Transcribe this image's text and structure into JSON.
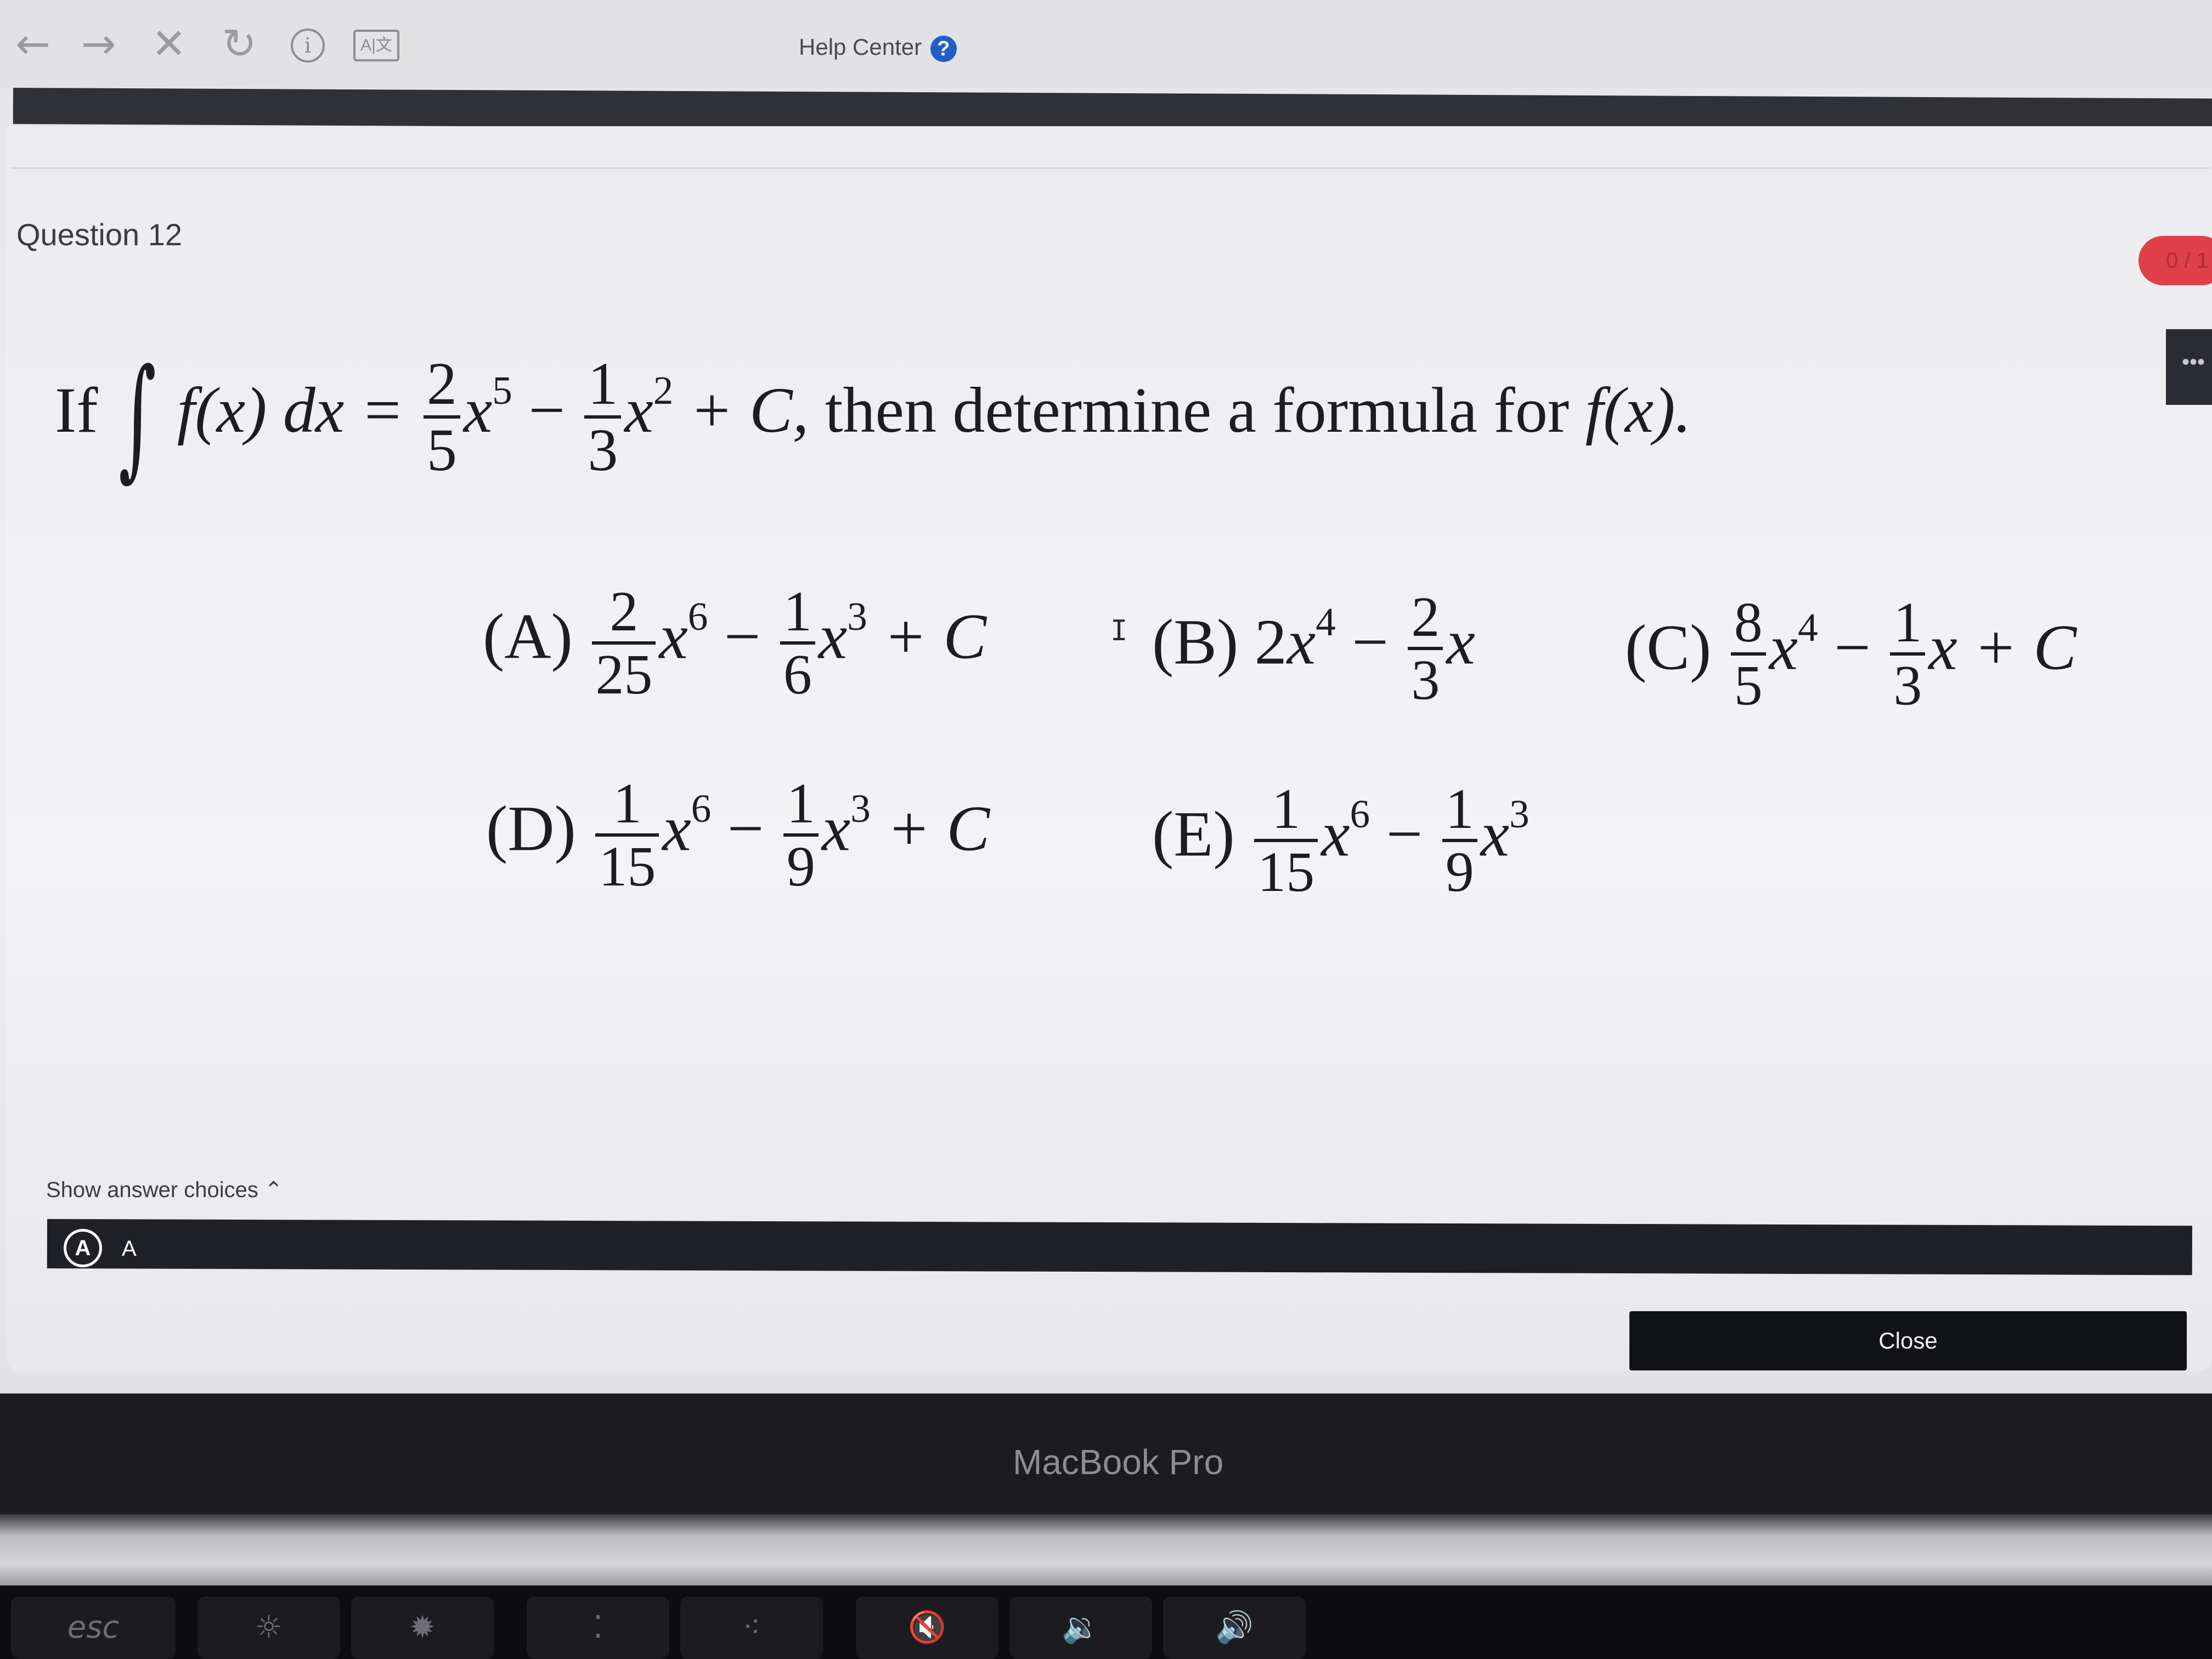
{
  "browser": {
    "back_icon": "←",
    "forward_icon": "→",
    "stop_icon": "✕",
    "reload_icon": "↻",
    "info_icon": "i",
    "translate_icon": "A|文",
    "help_center_label": "Help Center",
    "help_icon": "?"
  },
  "question": {
    "label": "Question 12",
    "score_badge": "0 / 1",
    "more_icon": "•••",
    "prompt": {
      "if": "If",
      "integral_symbol": "∫",
      "fx_dx": "f(x) dx =",
      "frac1_num": "2",
      "frac1_den": "5",
      "term1": "x",
      "term1_exp": "5",
      "minus": "−",
      "frac2_num": "1",
      "frac2_den": "3",
      "term2": "x",
      "term2_exp": "2",
      "plus_c": "+ C,",
      "tail": "then determine a formula for",
      "tail_fx": "f(x)."
    },
    "choices": {
      "A": {
        "label": "(A)",
        "f1n": "2",
        "f1d": "25",
        "x1": "x",
        "e1": "6",
        "op": "−",
        "f2n": "1",
        "f2d": "6",
        "x2": "x",
        "e2": "3",
        "end": "+ C"
      },
      "B": {
        "label": "(B)",
        "lead": "2",
        "x1": "x",
        "e1": "4",
        "op": "−",
        "f2n": "2",
        "f2d": "3",
        "x2": "x"
      },
      "C": {
        "label": "(C)",
        "f1n": "8",
        "f1d": "5",
        "x1": "x",
        "e1": "4",
        "op": "−",
        "f2n": "1",
        "f2d": "3",
        "x2": "x",
        "end": "+ C"
      },
      "D": {
        "label": "(D)",
        "f1n": "1",
        "f1d": "15",
        "x1": "x",
        "e1": "6",
        "op": "−",
        "f2n": "1",
        "f2d": "9",
        "x2": "x",
        "e2": "3",
        "end": "+ C"
      },
      "E": {
        "label": "(E)",
        "f1n": "1",
        "f1d": "15",
        "x1": "x",
        "e1": "6",
        "op": "−",
        "f2n": "1",
        "f2d": "9",
        "x2": "x",
        "e2": "3"
      }
    },
    "cursor": "I",
    "show_answer_choices": "Show answer choices ⌃",
    "selected_answer_letter": "A",
    "selected_answer_text": "A",
    "close_label": "Close"
  },
  "device": {
    "bezel_label": "MacBook Pro",
    "touchbar": {
      "esc": "esc",
      "brightness_down": "☼",
      "brightness_up": "✹",
      "kbd_down": "⁚",
      "kbd_up": "⁖",
      "mute": "🔇",
      "vol_down": "🔉",
      "vol_up": "🔊"
    }
  }
}
